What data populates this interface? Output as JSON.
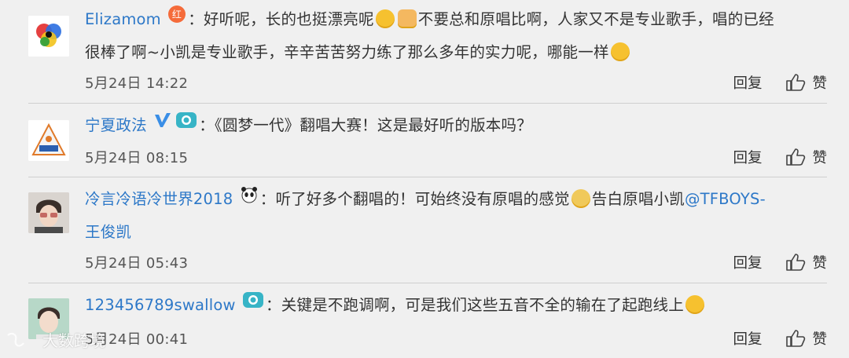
{
  "comments": [
    {
      "user": "Elizamom",
      "badge": "红",
      "sep": "：",
      "text_1": "好听呢，长的也挺漂亮呢",
      "text_2": "不要总和原唱比啊，人家又不是专业歌手，唱的已经",
      "text_3": "很棒了啊~小凯是专业歌手，辛辛苦苦努力练了那么多年的实力呢，哪能一样",
      "time": "5月24日 14:22",
      "reply": "回复",
      "like": "赞"
    },
    {
      "user": "宁夏政法",
      "sep": "：",
      "text_1": "《圆梦一代》翻唱大赛！这是最好听的版本吗？",
      "time": "5月24日 08:15",
      "reply": "回复",
      "like": "赞"
    },
    {
      "user": "冷言冷语冷世界2018",
      "sep": "：",
      "text_1": "听了好多个翻唱的！可始终没有原唱的感觉",
      "text_2": "告白原唱小凯",
      "mention_1": "@TFBOYS-",
      "mention_2": "王俊凯",
      "time": "5月24日 05:43",
      "reply": "回复",
      "like": "赞"
    },
    {
      "user": "123456789swallow",
      "sep": "：",
      "text_1": "关键是不跑调啊，可是我们这些五音不全的输在了起跑线上",
      "time": "5月24日 00:41",
      "reply": "回复",
      "like": "赞"
    }
  ],
  "watermark": "大数跨境",
  "colors": {
    "link": "#2d78c8",
    "background": "#f0f0f0",
    "divider": "#cfcfcf"
  }
}
